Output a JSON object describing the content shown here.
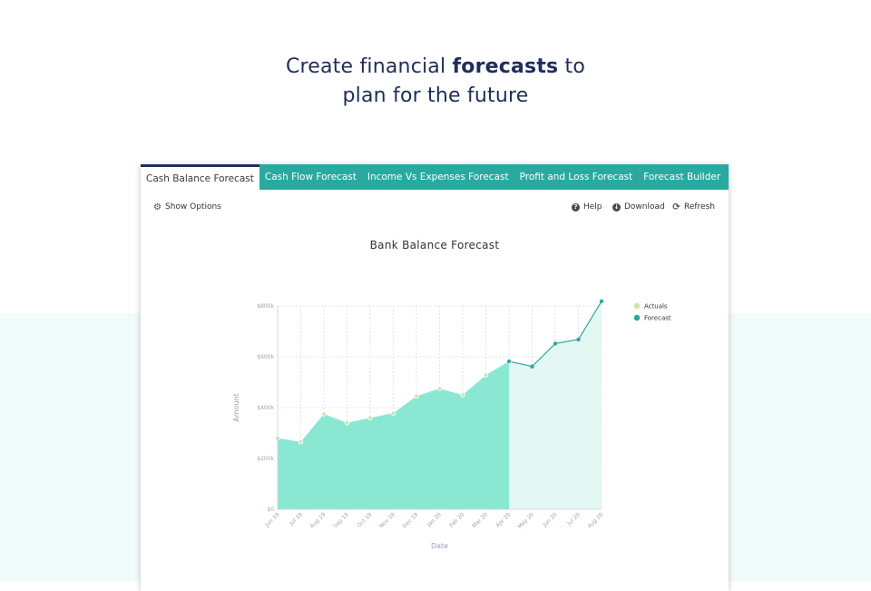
{
  "headline": {
    "line1_pre": "Create financial ",
    "line1_bold": "forecasts",
    "line1_post": " to",
    "line2": "plan for the future"
  },
  "tabs": [
    {
      "label": "Cash Balance Forecast",
      "active": true
    },
    {
      "label": "Cash Flow Forecast",
      "active": false
    },
    {
      "label": "Income Vs Expenses Forecast",
      "active": false
    },
    {
      "label": "Profit and Loss Forecast",
      "active": false
    },
    {
      "label": "Forecast Builder",
      "active": false
    }
  ],
  "toolbar": {
    "show_options": "Show Options",
    "help": "Help",
    "download": "Download",
    "refresh": "Refresh"
  },
  "colors": {
    "accent": "#2aa9a0",
    "nav_dark": "#1f2d5a",
    "actuals_fill": "#8ae8d2",
    "forecast_fill": "#e3f8f2",
    "forecast_line": "#2aa9a0",
    "actuals_marker": "#c8e6b0"
  },
  "chart_data": {
    "type": "area",
    "title": "Bank Balance Forecast",
    "xlabel": "Date",
    "ylabel": "Amount",
    "ylim": [
      0,
      800000
    ],
    "yticks": [
      "$0",
      "$200k",
      "$400k",
      "$600k",
      "$800k"
    ],
    "categories": [
      "Jun 19",
      "Jul 19",
      "Aug 19",
      "Sep 19",
      "Oct 19",
      "Nov 19",
      "Dec 19",
      "Jan 20",
      "Feb 20",
      "Mar 20",
      "Apr 20",
      "May 20",
      "Jun 20",
      "Jul 20",
      "Aug 20"
    ],
    "series": [
      {
        "name": "Actuals",
        "values": [
          280000,
          265000,
          375000,
          340000,
          360000,
          378000,
          445000,
          475000,
          450000,
          528000,
          582000,
          null,
          null,
          null,
          null
        ]
      },
      {
        "name": "Forecast",
        "values": [
          null,
          null,
          null,
          null,
          null,
          null,
          null,
          null,
          null,
          null,
          null,
          562000,
          652000,
          668000,
          818000
        ]
      }
    ],
    "legend_position": "top-right",
    "grid": true
  }
}
